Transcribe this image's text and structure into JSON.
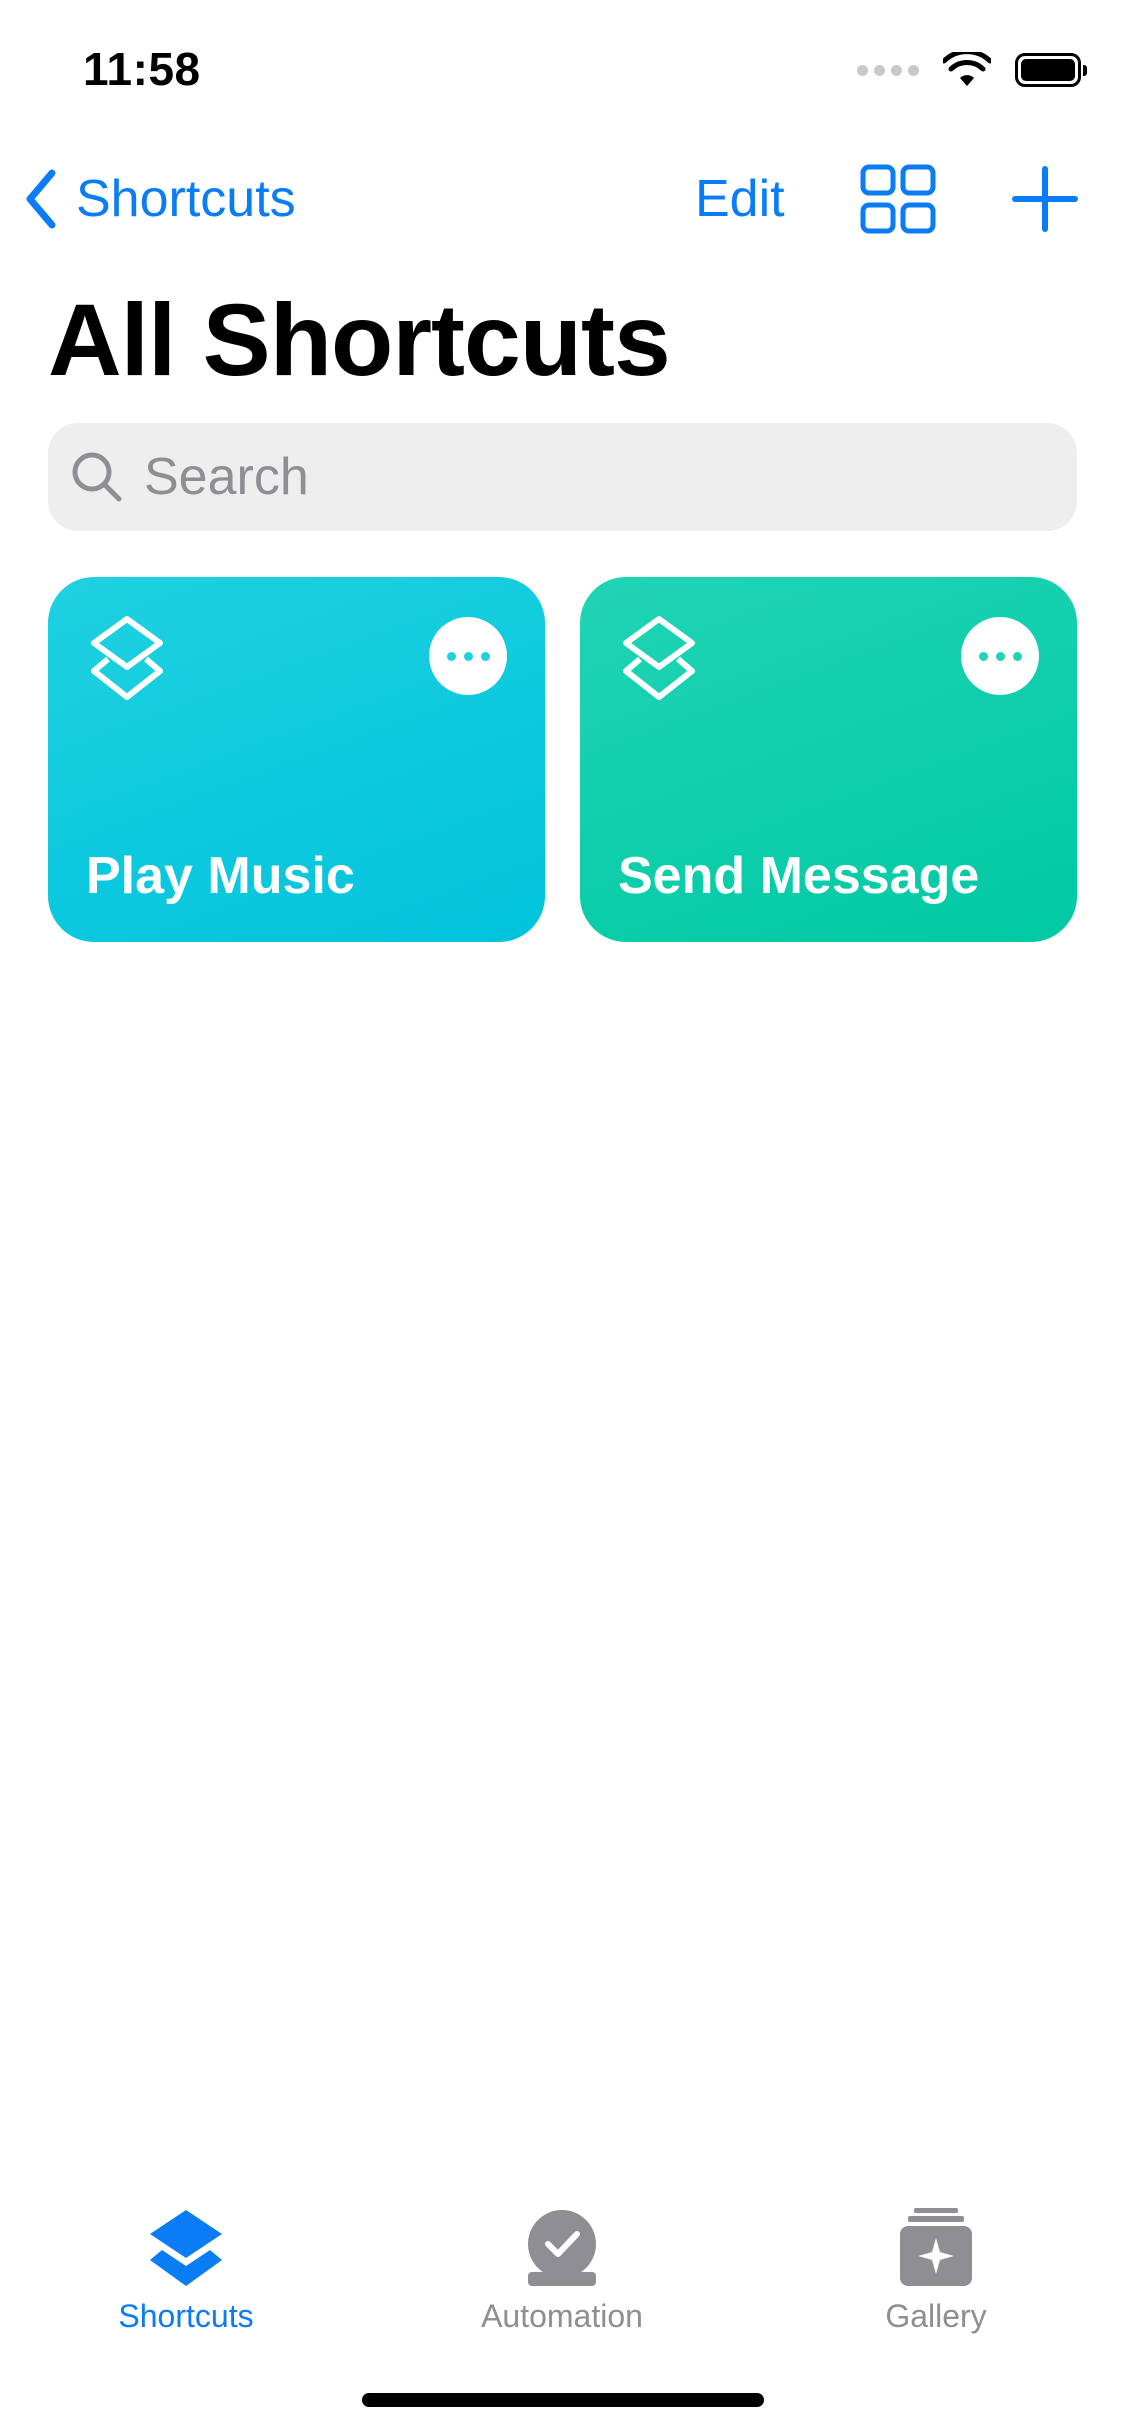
{
  "status_bar": {
    "time": "11:58"
  },
  "nav": {
    "back_label": "Shortcuts",
    "edit_label": "Edit",
    "accent_color": "#0a7cf5"
  },
  "page": {
    "title": "All Shortcuts"
  },
  "search": {
    "placeholder": "Search",
    "value": ""
  },
  "shortcuts": [
    {
      "label": "Play Music",
      "color": "#1fd1e0"
    },
    {
      "label": "Send Message",
      "color": "#20d4b5"
    }
  ],
  "tabbar": {
    "tabs": [
      {
        "label": "Shortcuts",
        "icon": "stack-icon",
        "selected": true
      },
      {
        "label": "Automation",
        "icon": "checkmark-circle-icon",
        "selected": false
      },
      {
        "label": "Gallery",
        "icon": "sparkle-stack-icon",
        "selected": false
      }
    ]
  }
}
